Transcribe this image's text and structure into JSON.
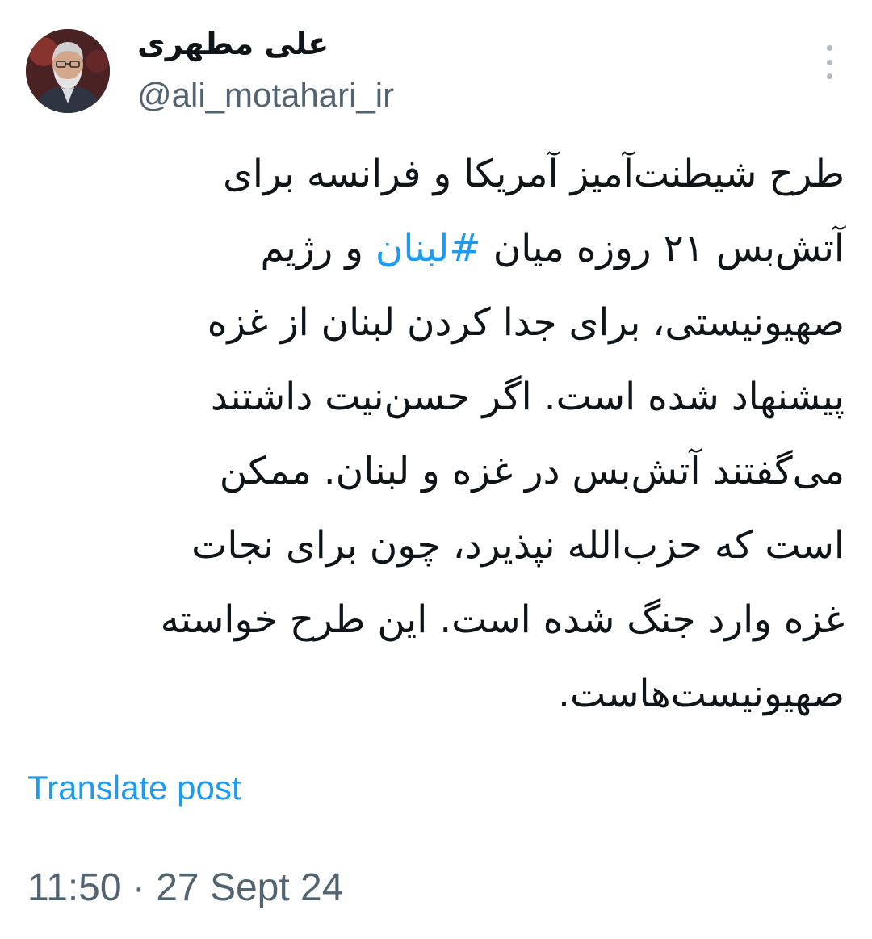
{
  "author": {
    "display_name": "علی مطهری",
    "handle": "@ali_motahari_ir"
  },
  "post": {
    "lines": [
      {
        "before": "طرح شیطنت‌آمیز آمریکا و فرانسه برای",
        "hashtag": "",
        "after": ""
      },
      {
        "before": "آتش‌بس ۲۱ روزه میان ",
        "hashtag": "#لبنان",
        "after": " و رژیم"
      },
      {
        "before": "صهیونیستی، برای جدا کردن لبنان از غزه",
        "hashtag": "",
        "after": ""
      },
      {
        "before": "پیشنهاد شده است. اگر حسن‌نیت داشتند",
        "hashtag": "",
        "after": ""
      },
      {
        "before": "می‌گفتند آتش‌بس در غزه و لبنان. ممکن",
        "hashtag": "",
        "after": ""
      },
      {
        "before": "است که حزب‌الله نپذیرد، چون برای نجات",
        "hashtag": "",
        "after": ""
      },
      {
        "before": "غزه وارد جنگ شده است. این طرح خواسته",
        "hashtag": "",
        "after": ""
      },
      {
        "before": "صهیونیست‌هاست.",
        "hashtag": "",
        "after": ""
      }
    ],
    "translate_label": "Translate post",
    "timestamp": "11:50 · 27 Sept 24"
  },
  "icons": {
    "avatar": "profile-photo",
    "more": "more-options-icon"
  },
  "colors": {
    "link": "#1d9bf0",
    "secondary_text": "#536471",
    "primary_text": "#0f1419"
  }
}
